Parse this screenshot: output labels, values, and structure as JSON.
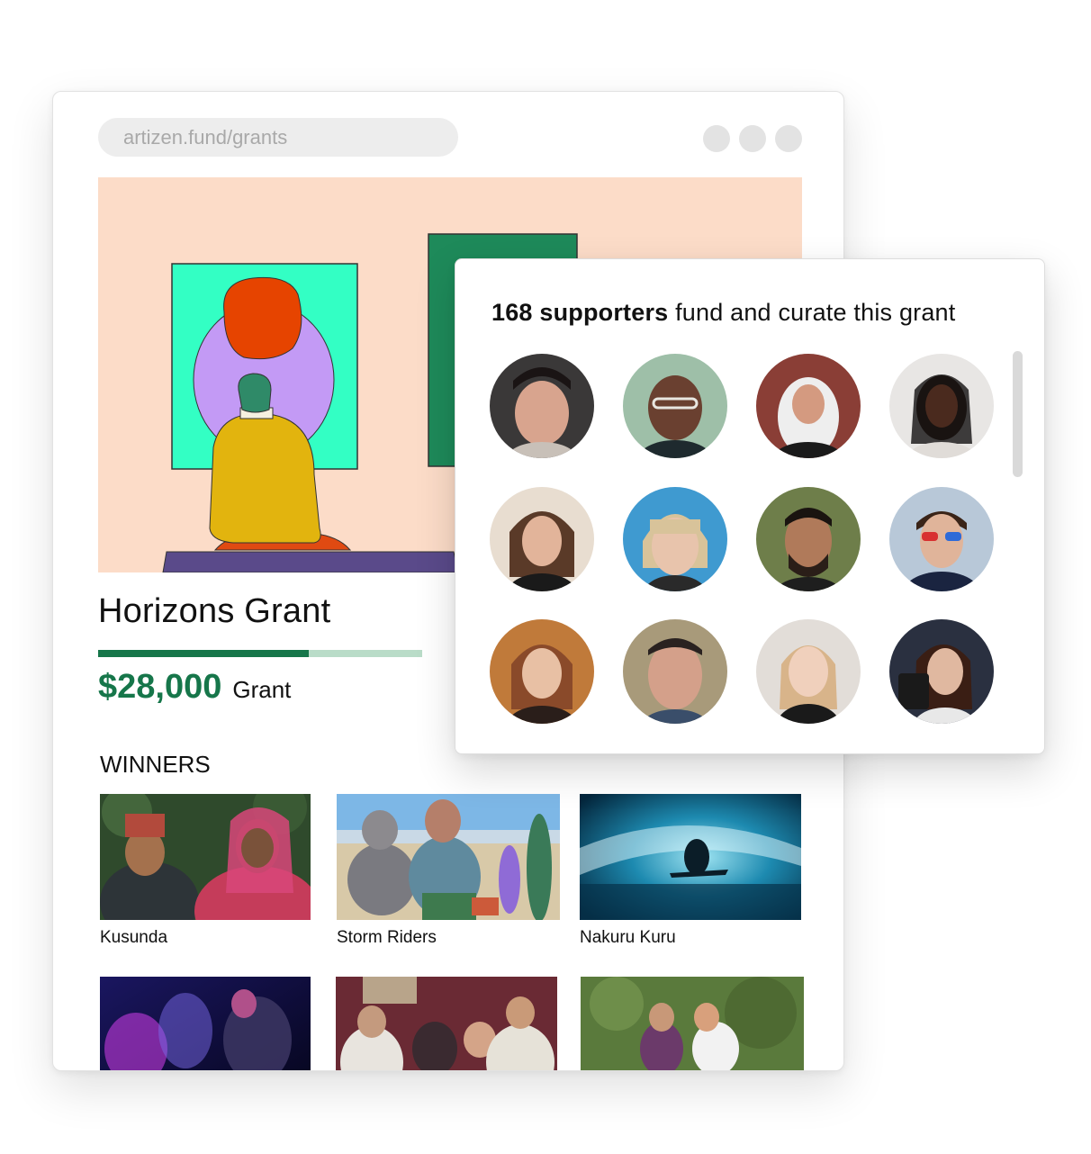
{
  "browser": {
    "url": "artizen.fund/grants"
  },
  "grant": {
    "title": "Horizons Grant",
    "progress": 0.65,
    "amount": "$28,000",
    "amount_label": "Grant"
  },
  "winners": {
    "heading": "WINNERS",
    "items": [
      {
        "name": "Kusunda"
      },
      {
        "name": "Storm Riders"
      },
      {
        "name": "Nakuru Kuru"
      },
      {
        "name": ""
      },
      {
        "name": ""
      },
      {
        "name": ""
      }
    ]
  },
  "supporters": {
    "count_text": "168 supporters",
    "rest_text": " fund and curate this grant"
  },
  "colors": {
    "accent_green": "#16764a",
    "progress_track": "#b9dcc8",
    "hero_bg": "#fcdcc8"
  }
}
